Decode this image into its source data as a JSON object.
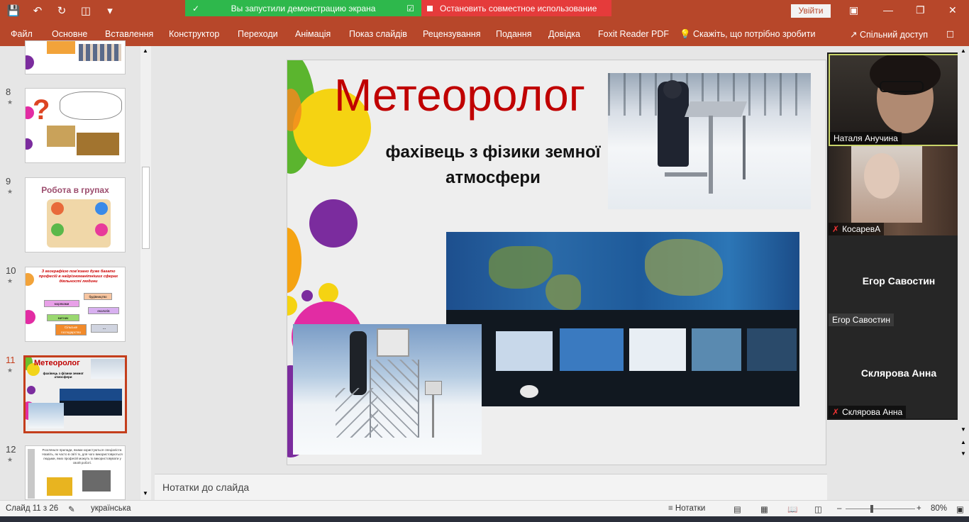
{
  "qat": {
    "save_icon": "save-icon",
    "undo_icon": "undo-icon",
    "redo_icon": "redo-icon",
    "present_icon": "present-icon",
    "customize_icon": "chevron-down-icon"
  },
  "banner": {
    "sharing_text": "Вы запустили демонстрацию экрана",
    "stop_text": "Остановить совместное использование"
  },
  "titlebar": {
    "signin": "Увійти"
  },
  "ribbon": {
    "tabs": [
      "Файл",
      "Основне",
      "Вставлення",
      "Конструктор",
      "Переходи",
      "Анімація",
      "Показ слайдів",
      "Рецензування",
      "Подання",
      "Довідка",
      "Foxit Reader PDF",
      "Скажіть, що потрібно зробити"
    ],
    "share": "Спільний доступ"
  },
  "thumbnails": [
    {
      "num": "8",
      "star": "★"
    },
    {
      "num": "9",
      "star": "★",
      "title": "Робота в групах"
    },
    {
      "num": "10",
      "star": "★",
      "title": "З географією пов'язано дуже багато професій в найрізноманітніших сферах діяльності людини",
      "items": [
        "будівництво",
        "моряками",
        "екологів",
        "митник",
        "Сільське господарство",
        "..."
      ]
    },
    {
      "num": "11",
      "star": "★",
      "title": "Метеоролог",
      "sub": "фахівець з фізики земної атмосфери"
    },
    {
      "num": "12",
      "star": "★",
      "text": "Розгляньте прилади, якими користуються спеціалісти. Назвіть, як часто в світі їх, для чого використовуються людьми, яких професій можуть їх використовувати у своїй роботі."
    }
  ],
  "slide": {
    "title": "Метеоролог",
    "subtitle": "фахівець з фізики земної атмосфери"
  },
  "notes": {
    "placeholder": "Нотатки до слайда"
  },
  "participants": [
    {
      "name": "Наталя Анучина",
      "muted": false
    },
    {
      "name": "КосаревА",
      "muted": true
    },
    {
      "name": "Егор Савостин",
      "muted": false
    },
    {
      "name": "Склярова Анна",
      "muted": true
    }
  ],
  "status": {
    "slide_counter": "Слайд 11 з 26",
    "language": "українська",
    "notes_button": "Нотатки",
    "zoom": "80%"
  }
}
